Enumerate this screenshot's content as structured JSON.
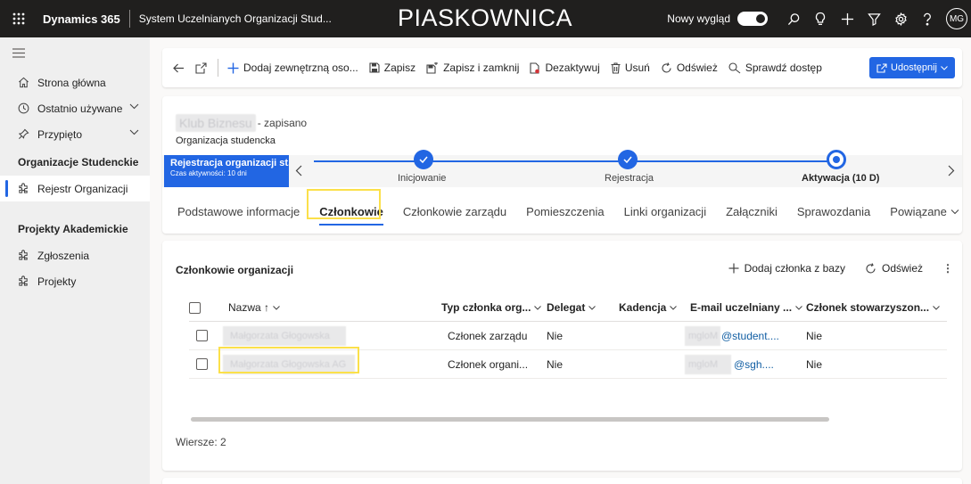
{
  "topbar": {
    "brand": "Dynamics 365",
    "app_name": "System Uczelnianych Organizacji Stud...",
    "environment": "PIASKOWNICA",
    "new_look_label": "Nowy wygląd",
    "new_look_on": true,
    "avatar_initials": "MG"
  },
  "nav": {
    "items": [
      {
        "label": "Strona główna",
        "icon": "home-icon"
      },
      {
        "label": "Ostatnio używane",
        "icon": "clock-icon"
      },
      {
        "label": "Przypięto",
        "icon": "pin-icon"
      }
    ],
    "groups": [
      {
        "header": "Organizacje Studenckie",
        "items": [
          {
            "label": "Rejestr Organizacji",
            "icon": "puzzle-icon",
            "active": true
          }
        ]
      },
      {
        "header": "Projekty Akademickie",
        "items": [
          {
            "label": "Zgłoszenia",
            "icon": "puzzle-icon"
          },
          {
            "label": "Projekty",
            "icon": "puzzle-icon"
          }
        ]
      }
    ]
  },
  "commands": {
    "add_external": "Dodaj zewnętrzną oso...",
    "save": "Zapisz",
    "save_close": "Zapisz i zamknij",
    "deactivate": "Dezaktywuj",
    "delete": "Usuń",
    "refresh": "Odśwież",
    "check_access": "Sprawdź dostęp",
    "share": "Udostępnij"
  },
  "record": {
    "name": "Klub Biznesu",
    "saved_status": "- zapisano",
    "entity_type": "Organizacja studencka"
  },
  "bpf": {
    "active_stage_name": "Rejestracja organizacji st...",
    "active_stage_time": "Czas aktywności: 10 dni",
    "stages": [
      {
        "label": "Inicjowanie",
        "state": "done"
      },
      {
        "label": "Rejestracja",
        "state": "done"
      },
      {
        "label": "Aktywacja (10 D)",
        "state": "current"
      }
    ]
  },
  "tabs": [
    {
      "label": "Podstawowe informacje",
      "selected": false
    },
    {
      "label": "Członkowie",
      "selected": true
    },
    {
      "label": "Członkowie zarządu",
      "selected": false
    },
    {
      "label": "Pomieszczenia",
      "selected": false
    },
    {
      "label": "Linki organizacji",
      "selected": false
    },
    {
      "label": "Załączniki",
      "selected": false
    },
    {
      "label": "Sprawozdania",
      "selected": false
    },
    {
      "label": "Powiązane",
      "selected": false
    }
  ],
  "subgrid": {
    "title": "Członkowie organizacji",
    "add_label": "Dodaj członka z bazy",
    "refresh_label": "Odśwież",
    "more_label": "⋮",
    "columns": [
      "Nazwa ↑",
      "Typ członka org...",
      "Delegat",
      "Kadencja",
      "E-mail uczelniany ...",
      "Członek stowarzyszon..."
    ],
    "rows": [
      {
        "name": "Małgorzata Głogowska",
        "type": "Członek zarządu",
        "delegate": "Nie",
        "term": "",
        "email_prefix": "mgloM",
        "email": "@student....",
        "association": "Nie"
      },
      {
        "name": "Małgorzata Głogowska AG",
        "type": "Członek organi...",
        "delegate": "Nie",
        "term": "",
        "email_prefix": "mgloM",
        "email": "@sgh....",
        "association": "Nie"
      }
    ],
    "rows_count": "Wiersze: 2"
  },
  "colors": {
    "topbar": "#201f1e",
    "accent": "#2266e3",
    "highlight": "#fbe04a"
  }
}
